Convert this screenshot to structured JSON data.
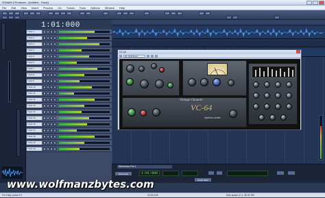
{
  "window": {
    "title": "SONAR 6 Producer - [Untitled - Track]"
  },
  "menu": {
    "items": [
      "File",
      "Edit",
      "View",
      "Insert",
      "Process",
      "Go",
      "Tracks",
      "Tools",
      "Options",
      "Window",
      "Help"
    ]
  },
  "transport": {
    "time": "1:01:000"
  },
  "tracks": [
    {
      "name": "Track 1"
    },
    {
      "name": "Track 2"
    },
    {
      "name": "Track 3"
    },
    {
      "name": "Track 4"
    },
    {
      "name": "Track 5"
    },
    {
      "name": "Track 6"
    },
    {
      "name": "Track 7"
    },
    {
      "name": "Track 8"
    },
    {
      "name": "Track 9"
    },
    {
      "name": "Track 10"
    },
    {
      "name": "Track 11"
    },
    {
      "name": "Track 12"
    },
    {
      "name": "Track 13"
    },
    {
      "name": "Track 14"
    },
    {
      "name": "Track 15"
    },
    {
      "name": "Track 16"
    },
    {
      "name": "Track 17"
    },
    {
      "name": "Track 18"
    },
    {
      "name": "Track 19"
    },
    {
      "name": "Track 20"
    }
  ],
  "plugin": {
    "title": "VC-64",
    "preset": "01: Null Reset",
    "product": "Vintage Channel",
    "logo": "VC-64",
    "vendor": "Kjaerhus Audio"
  },
  "bottom_panel": {
    "title": "Dimension Pro 1",
    "button_1": "Dimension",
    "button_2": "Synth Rack",
    "lcd_1": "1:01:000"
  },
  "status": {
    "left": "For Help, press F1",
    "mid": "20:04:195",
    "right": "Disk space (C:): 38.99 GB"
  },
  "watermark": "www.wolfmanzbytes.com",
  "colors": {
    "accent": "#2b3a55",
    "meter_green": "#2fb34a",
    "plugin_knob_green": "#1d5a2b",
    "plugin_knob_red": "#6a1b1b"
  }
}
